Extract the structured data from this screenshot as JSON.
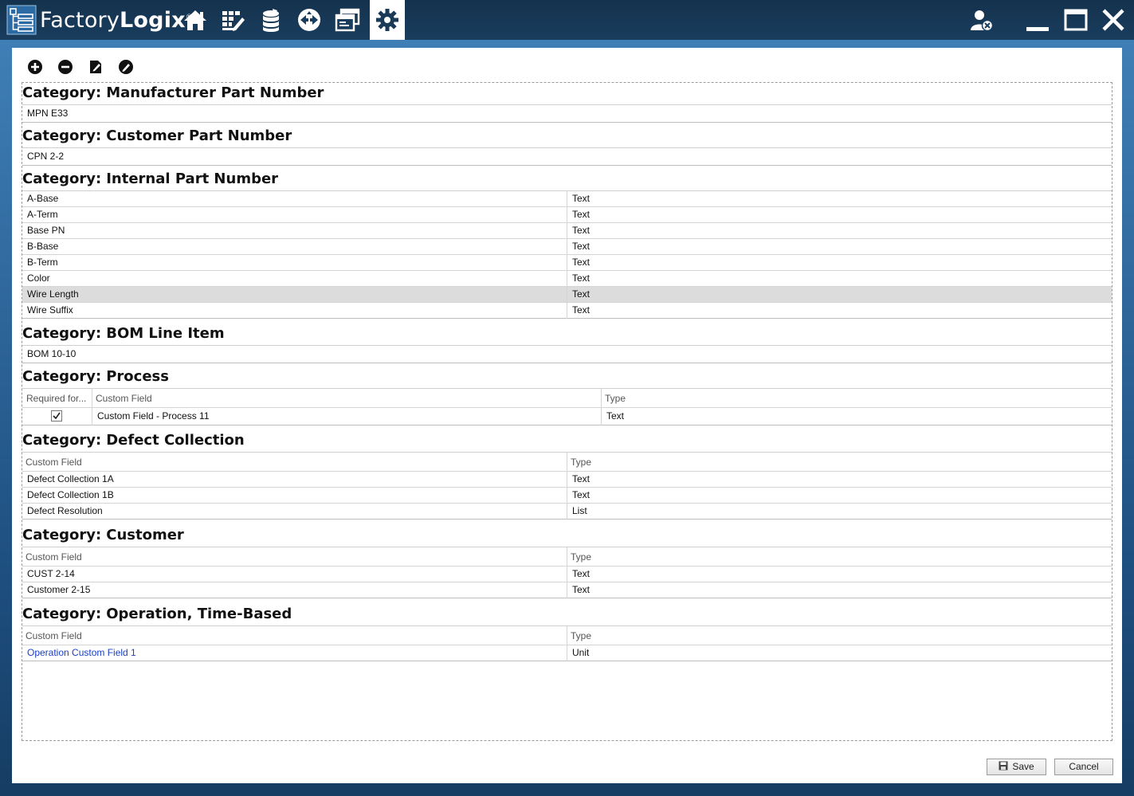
{
  "app": {
    "title_plain": "Factory",
    "title_bold": "Logix",
    "registered": "®"
  },
  "nav": [
    {
      "icon": "home-icon"
    },
    {
      "icon": "edit-grid-icon"
    },
    {
      "icon": "database-icon"
    },
    {
      "icon": "navigate-icon"
    },
    {
      "icon": "windows-icon"
    },
    {
      "icon": "gear-icon",
      "active": true
    }
  ],
  "toolbar": {
    "add": "add-icon",
    "remove": "remove-icon",
    "edit": "edit-icon",
    "disable": "disable-icon"
  },
  "categories": {
    "label": "Category:",
    "mpn": {
      "name": "Manufacturer Part Number",
      "value": "MPN E33"
    },
    "cpn": {
      "name": "Customer Part Number",
      "value": "CPN 2-2"
    },
    "ipn": {
      "name": "Internal Part Number",
      "rows": [
        {
          "field": "A-Base",
          "type": "Text"
        },
        {
          "field": "A-Term",
          "type": "Text"
        },
        {
          "field": "Base PN",
          "type": "Text"
        },
        {
          "field": "B-Base",
          "type": "Text"
        },
        {
          "field": "B-Term",
          "type": "Text"
        },
        {
          "field": "Color",
          "type": "Text"
        },
        {
          "field": "Wire Length",
          "type": "Text",
          "selected": true
        },
        {
          "field": "Wire Suffix",
          "type": "Text"
        }
      ]
    },
    "bom": {
      "name": "BOM Line Item",
      "value": "BOM 10-10"
    },
    "process": {
      "name": "Process",
      "headers": {
        "required": "Required for...",
        "field": "Custom Field",
        "type": "Type"
      },
      "rows": [
        {
          "required": true,
          "field": "Custom Field - Process 11",
          "type": "Text"
        }
      ]
    },
    "defect": {
      "name": "Defect Collection",
      "headers": {
        "field": "Custom Field",
        "type": "Type"
      },
      "rows": [
        {
          "field": "Defect Collection 1A",
          "type": "Text"
        },
        {
          "field": "Defect Collection 1B",
          "type": "Text"
        },
        {
          "field": "Defect Resolution",
          "type": "List"
        }
      ]
    },
    "customer": {
      "name": "Customer",
      "headers": {
        "field": "Custom Field",
        "type": "Type"
      },
      "rows": [
        {
          "field": "CUST 2-14",
          "type": "Text"
        },
        {
          "field": "Customer 2-15",
          "type": "Text"
        }
      ]
    },
    "operation": {
      "name": "Operation, Time-Based",
      "headers": {
        "field": "Custom Field",
        "type": "Type"
      },
      "rows": [
        {
          "field": "Operation Custom Field 1",
          "type": "Unit"
        }
      ]
    }
  },
  "footer": {
    "save": "Save",
    "cancel": "Cancel"
  },
  "colors": {
    "titlebar": "#14324d",
    "accent": "#3f7fb6",
    "link": "#1a3fc4",
    "selected_row": "#dcdcdc"
  }
}
